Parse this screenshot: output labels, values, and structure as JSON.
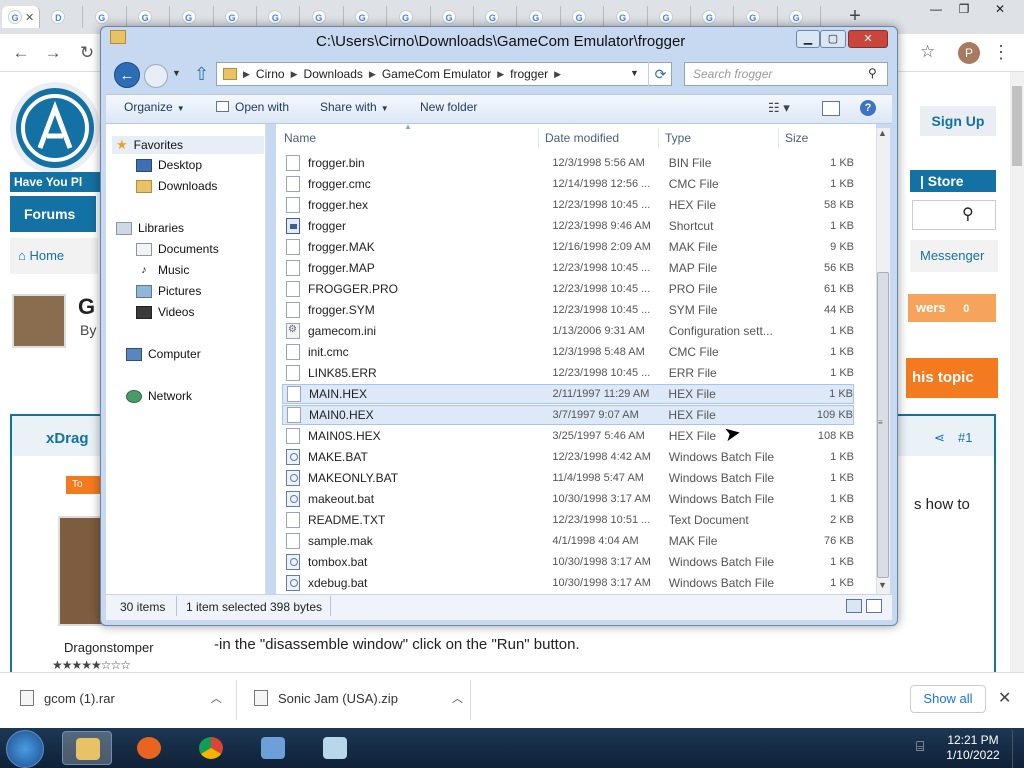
{
  "browser": {
    "tabs": [
      {
        "label": "G"
      },
      {
        "label": "D"
      },
      {
        "label": "G"
      },
      {
        "label": "G"
      },
      {
        "label": "G"
      },
      {
        "label": "G"
      },
      {
        "label": "G"
      },
      {
        "label": "G"
      },
      {
        "label": "G"
      },
      {
        "label": "G"
      },
      {
        "label": "G"
      },
      {
        "label": "G"
      },
      {
        "label": "G"
      },
      {
        "label": "G"
      },
      {
        "label": "G"
      },
      {
        "label": "G"
      },
      {
        "label": "G"
      },
      {
        "label": "G"
      },
      {
        "label": "G"
      }
    ],
    "profile_initial": "P",
    "new_tab_glyph": "+",
    "minimize_glyph": "—",
    "restore_glyph": "❐",
    "close_glyph": "✕"
  },
  "forum": {
    "logo_text": "Have You Pl",
    "forums_tab": "Forums",
    "home_crumb": "Home",
    "sign_up": "Sign Up",
    "store": "| Store",
    "messenger": "Messenger",
    "answers": "wers",
    "answers_count": "0",
    "reply_topic": "his topic",
    "title_frag": "G",
    "by_frag": "By",
    "post_author_header": "xDrag",
    "post_number": "#1",
    "badge": "To",
    "username": "Dragonstomper",
    "stars": "★★★★★☆☆☆",
    "body_fragment": "s how to",
    "instruction_line": "-in the \"disassemble window\" click on the \"Run\" button."
  },
  "explorer": {
    "title": "C:\\Users\\Cirno\\Downloads\\GameCom Emulator\\frogger",
    "breadcrumb": [
      "Cirno",
      "Downloads",
      "GameCom Emulator",
      "frogger"
    ],
    "search_placeholder": "Search frogger",
    "toolbar": {
      "organize": "Organize",
      "open_with": "Open with",
      "share_with": "Share with",
      "new_folder": "New folder"
    },
    "nav": {
      "favorites": "Favorites",
      "desktop": "Desktop",
      "downloads": "Downloads",
      "libraries": "Libraries",
      "documents": "Documents",
      "music": "Music",
      "pictures": "Pictures",
      "videos": "Videos",
      "computer": "Computer",
      "network": "Network"
    },
    "columns": {
      "name": "Name",
      "date": "Date modified",
      "type": "Type",
      "size": "Size"
    },
    "files": [
      {
        "name": "frogger.bin",
        "date": "12/3/1998 5:56 AM",
        "type": "BIN File",
        "size": "1 KB",
        "icon": "file-icon"
      },
      {
        "name": "frogger.cmc",
        "date": "12/14/1998 12:56 ...",
        "type": "CMC File",
        "size": "1 KB",
        "icon": "file-icon"
      },
      {
        "name": "frogger.hex",
        "date": "12/23/1998 10:45 ...",
        "type": "HEX File",
        "size": "58 KB",
        "icon": "file-icon"
      },
      {
        "name": "frogger",
        "date": "12/23/1998 9:46 AM",
        "type": "Shortcut",
        "size": "1 KB",
        "icon": "shortcut-icon"
      },
      {
        "name": "frogger.MAK",
        "date": "12/16/1998 2:09 AM",
        "type": "MAK File",
        "size": "9 KB",
        "icon": "file-icon"
      },
      {
        "name": "frogger.MAP",
        "date": "12/23/1998 10:45 ...",
        "type": "MAP File",
        "size": "56 KB",
        "icon": "file-icon"
      },
      {
        "name": "FROGGER.PRO",
        "date": "12/23/1998 10:45 ...",
        "type": "PRO File",
        "size": "61 KB",
        "icon": "file-icon"
      },
      {
        "name": "frogger.SYM",
        "date": "12/23/1998 10:45 ...",
        "type": "SYM File",
        "size": "44 KB",
        "icon": "file-icon"
      },
      {
        "name": "gamecom.ini",
        "date": "1/13/2006 9:31 AM",
        "type": "Configuration sett...",
        "size": "1 KB",
        "icon": "settings-file-icon"
      },
      {
        "name": "init.cmc",
        "date": "12/3/1998 5:48 AM",
        "type": "CMC File",
        "size": "1 KB",
        "icon": "file-icon"
      },
      {
        "name": "LINK85.ERR",
        "date": "12/23/1998 10:45 ...",
        "type": "ERR File",
        "size": "1 KB",
        "icon": "file-icon"
      },
      {
        "name": "MAIN.HEX",
        "date": "2/11/1997 11:29 AM",
        "type": "HEX File",
        "size": "1 KB",
        "icon": "file-icon",
        "selected": true
      },
      {
        "name": "MAIN0.HEX",
        "date": "3/7/1997 9:07 AM",
        "type": "HEX File",
        "size": "109 KB",
        "icon": "file-icon",
        "selected": true
      },
      {
        "name": "MAIN0S.HEX",
        "date": "3/25/1997 5:46 AM",
        "type": "HEX File",
        "size": "108 KB",
        "icon": "file-icon"
      },
      {
        "name": "MAKE.BAT",
        "date": "12/23/1998 4:42 AM",
        "type": "Windows Batch File",
        "size": "1 KB",
        "icon": "batch-file-icon"
      },
      {
        "name": "MAKEONLY.BAT",
        "date": "11/4/1998 5:47 AM",
        "type": "Windows Batch File",
        "size": "1 KB",
        "icon": "batch-file-icon"
      },
      {
        "name": "makeout.bat",
        "date": "10/30/1998 3:17 AM",
        "type": "Windows Batch File",
        "size": "1 KB",
        "icon": "batch-file-icon"
      },
      {
        "name": "README.TXT",
        "date": "12/23/1998 10:51 ...",
        "type": "Text Document",
        "size": "2 KB",
        "icon": "text-file-icon"
      },
      {
        "name": "sample.mak",
        "date": "4/1/1998 4:04 AM",
        "type": "MAK File",
        "size": "76 KB",
        "icon": "file-icon"
      },
      {
        "name": "tombox.bat",
        "date": "10/30/1998 3:17 AM",
        "type": "Windows Batch File",
        "size": "1 KB",
        "icon": "batch-file-icon"
      },
      {
        "name": "xdebug.bat",
        "date": "10/30/1998 3:17 AM",
        "type": "Windows Batch File",
        "size": "1 KB",
        "icon": "batch-file-icon"
      }
    ],
    "status": {
      "count": "30 items",
      "selected": "1 item selected",
      "size": "398 bytes"
    }
  },
  "downloads": {
    "items": [
      {
        "name": "gcom (1).rar"
      },
      {
        "name": "Sonic Jam (USA).zip"
      }
    ],
    "show_all": "Show all"
  },
  "taskbar": {
    "time": "12:21 PM",
    "date": "1/10/2022"
  },
  "colors": {
    "accent": "#1471a3",
    "orange": "#f47a1f",
    "selection": "#dde9f8"
  }
}
